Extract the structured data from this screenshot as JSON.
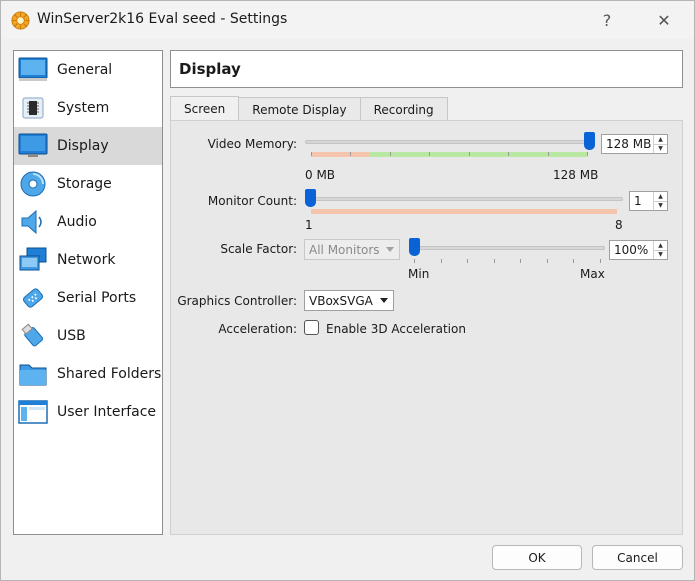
{
  "window": {
    "title": "WinServer2k16 Eval seed - Settings",
    "help_label": "?",
    "close_label": "✕"
  },
  "sidebar": {
    "items": [
      {
        "label": "General",
        "icon": "general-icon"
      },
      {
        "label": "System",
        "icon": "system-icon"
      },
      {
        "label": "Display",
        "icon": "display-icon",
        "selected": true
      },
      {
        "label": "Storage",
        "icon": "storage-icon"
      },
      {
        "label": "Audio",
        "icon": "audio-icon"
      },
      {
        "label": "Network",
        "icon": "network-icon"
      },
      {
        "label": "Serial Ports",
        "icon": "serial-ports-icon"
      },
      {
        "label": "USB",
        "icon": "usb-icon"
      },
      {
        "label": "Shared Folders",
        "icon": "shared-folders-icon"
      },
      {
        "label": "User Interface",
        "icon": "user-interface-icon"
      }
    ]
  },
  "header": {
    "title": "Display"
  },
  "tabs": [
    {
      "label": "Screen",
      "active": true
    },
    {
      "label": "Remote Display"
    },
    {
      "label": "Recording"
    }
  ],
  "screen": {
    "video_memory": {
      "label": "Video Memory:",
      "value": "128 MB",
      "min_label": "0 MB",
      "max_label": "128 MB",
      "level": 1.0
    },
    "monitor_count": {
      "label": "Monitor Count:",
      "value": "1",
      "min_label": "1",
      "max_label": "8",
      "level": 0.0
    },
    "scale_factor": {
      "label": "Scale Factor:",
      "monitors_select": "All Monitors",
      "value": "100%",
      "min_label": "Min",
      "max_label": "Max",
      "level": 0.0
    },
    "graphics_controller": {
      "label": "Graphics Controller:",
      "value": "VBoxSVGA"
    },
    "acceleration": {
      "label": "Acceleration:",
      "checkbox_label": "Enable 3D Acceleration",
      "checked": false
    }
  },
  "buttons": {
    "ok": "OK",
    "cancel": "Cancel"
  },
  "colors": {
    "accent": "#0a63d6",
    "range_red": "#f4c4ad",
    "range_green": "#b9e8a3"
  }
}
